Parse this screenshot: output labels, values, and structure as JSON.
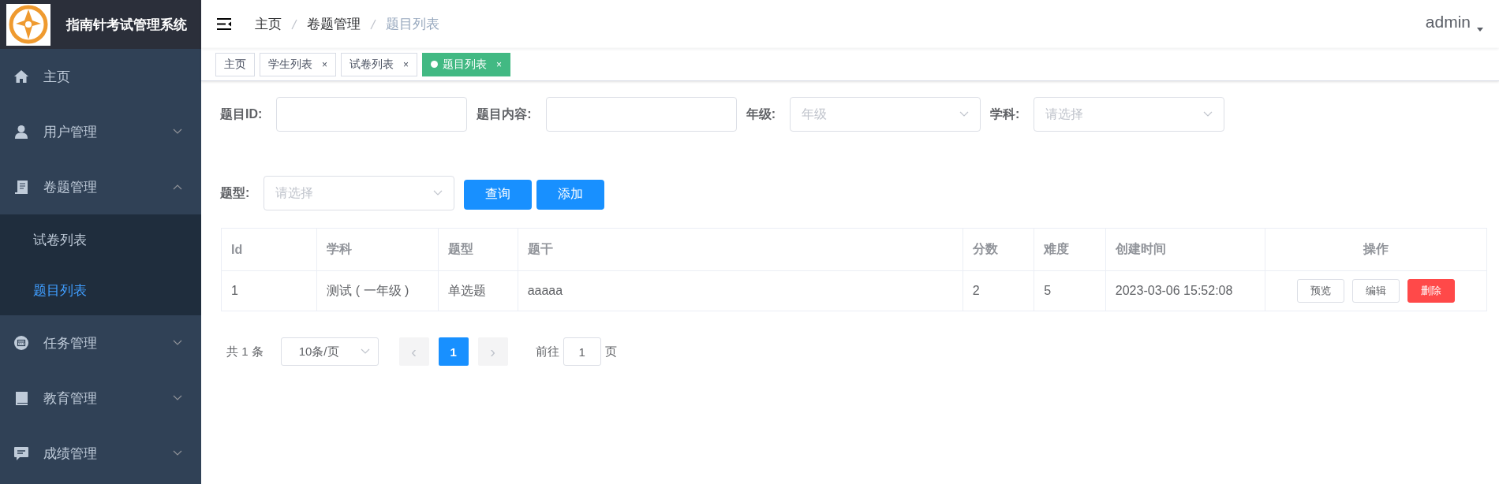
{
  "app": {
    "title": "指南针考试管理系统"
  },
  "sidebar": {
    "items": [
      {
        "label": "主页",
        "kind": "link"
      },
      {
        "label": "用户管理",
        "kind": "submenu",
        "expanded": false
      },
      {
        "label": "卷题管理",
        "kind": "submenu",
        "expanded": true,
        "children": [
          {
            "label": "试卷列表",
            "selected": false
          },
          {
            "label": "题目列表",
            "selected": true
          }
        ]
      },
      {
        "label": "任务管理",
        "kind": "submenu",
        "expanded": false
      },
      {
        "label": "教育管理",
        "kind": "submenu",
        "expanded": false
      },
      {
        "label": "成绩管理",
        "kind": "submenu",
        "expanded": false
      }
    ]
  },
  "breadcrumb": [
    {
      "label": "主页",
      "current": false
    },
    {
      "label": "卷题管理",
      "current": false
    },
    {
      "label": "题目列表",
      "current": true
    }
  ],
  "user": {
    "name": "admin"
  },
  "tabs": [
    {
      "label": "主页",
      "selected": false,
      "closable": false
    },
    {
      "label": "学生列表",
      "selected": false,
      "closable": true,
      "close": "×"
    },
    {
      "label": "试卷列表",
      "selected": false,
      "closable": true,
      "close": "×"
    },
    {
      "label": "题目列表",
      "selected": true,
      "closable": true,
      "close": "×"
    }
  ],
  "filters": [
    {
      "label": "题目ID:",
      "kind": "input"
    },
    {
      "label": "题目内容:",
      "kind": "input"
    },
    {
      "label": "年级:",
      "kind": "select",
      "placeholder": "年级"
    },
    {
      "label": "学科:",
      "kind": "select",
      "placeholder": "请选择"
    },
    {
      "label": "题型:",
      "kind": "select",
      "placeholder": "请选择"
    }
  ],
  "buttons": [
    {
      "label": "查询"
    },
    {
      "label": "添加"
    }
  ],
  "table": {
    "columns": [
      "Id",
      "学科",
      "题型",
      "题干",
      "分数",
      "难度",
      "创建时间",
      "操作"
    ],
    "rows": [
      {
        "cells": [
          "1",
          "测试 ( 一年级 )",
          "单选题",
          "aaaaa",
          "2",
          "5",
          "2023-03-06 15:52:08"
        ],
        "actions": [
          {
            "label": "预览",
            "kind": "default"
          },
          {
            "label": "编辑",
            "kind": "default"
          },
          {
            "label": "删除",
            "kind": "danger"
          }
        ]
      }
    ]
  },
  "pagination": {
    "total": "共 1 条",
    "page_size": "10条/页",
    "prev": "‹",
    "next": "›",
    "pages": [
      {
        "label": "1",
        "selected": true
      }
    ],
    "goto_label": "前往",
    "goto_value": "1",
    "goto_suffix": "页"
  }
}
